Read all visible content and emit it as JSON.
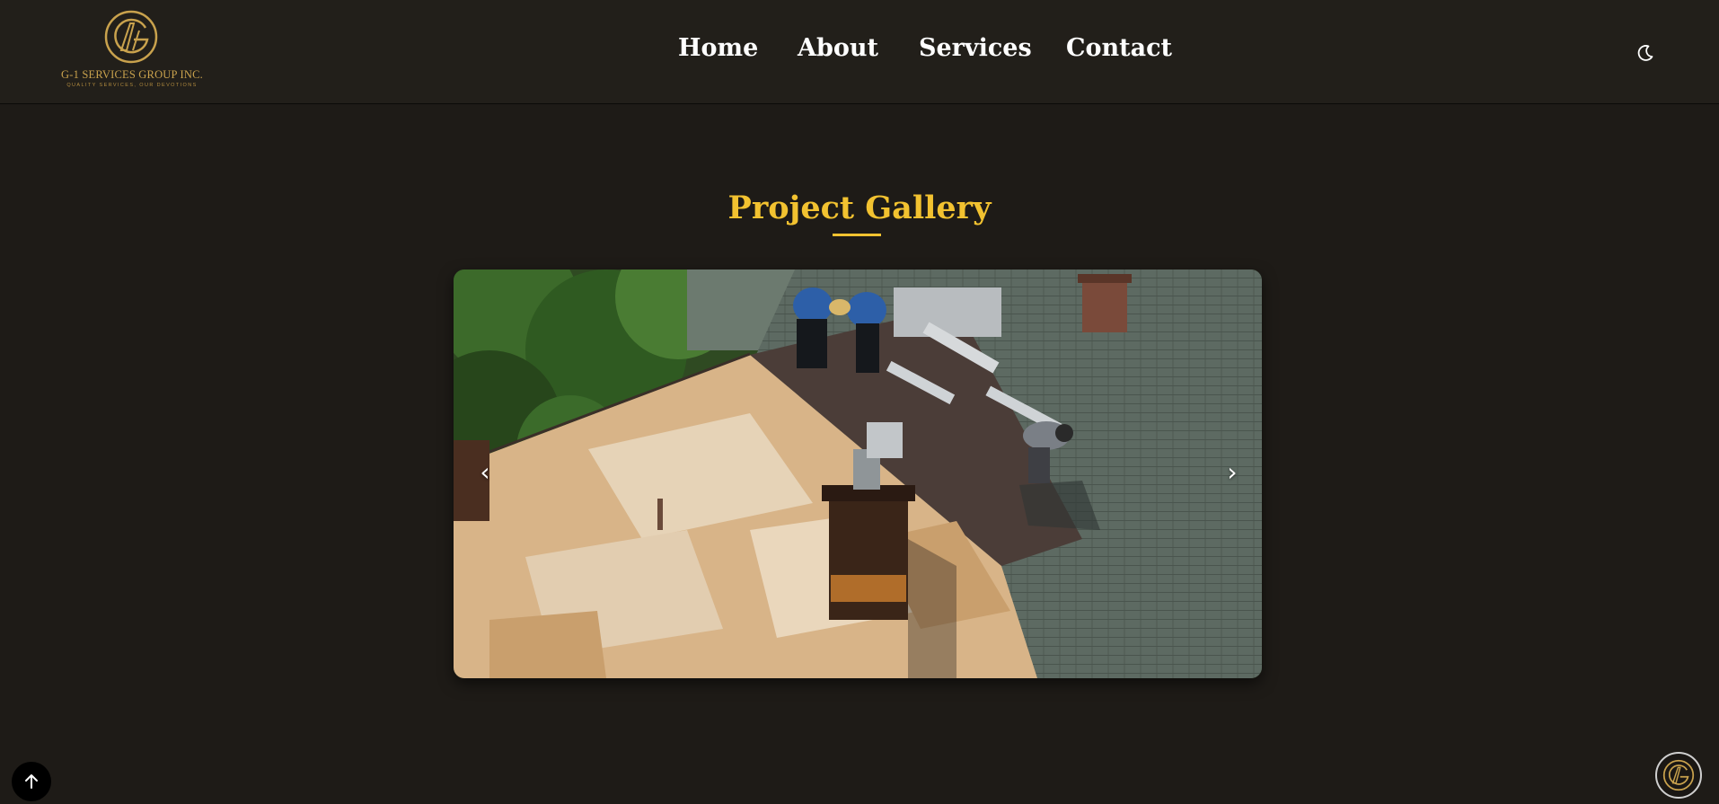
{
  "brand": {
    "name": "G-1 SERVICES GROUP INC.",
    "tagline": "QUALITY SERVICES, OUR DEVOTIONS",
    "logo_icon": "g1-monogram-logo",
    "accent_color": "#c9a24d"
  },
  "nav": {
    "items": [
      {
        "label": "Home"
      },
      {
        "label": "About"
      },
      {
        "label": "Services"
      },
      {
        "label": "Contact"
      }
    ],
    "theme_toggle_icon": "moon-icon"
  },
  "gallery": {
    "title": "Project Gallery",
    "title_color": "#f2c230",
    "prev_label": "‹",
    "next_label": "›",
    "slide_description_icon": "roofing-photo"
  },
  "floating": {
    "scroll_top_icon": "arrow-up-icon",
    "badge_icon": "g1-monogram-logo"
  }
}
